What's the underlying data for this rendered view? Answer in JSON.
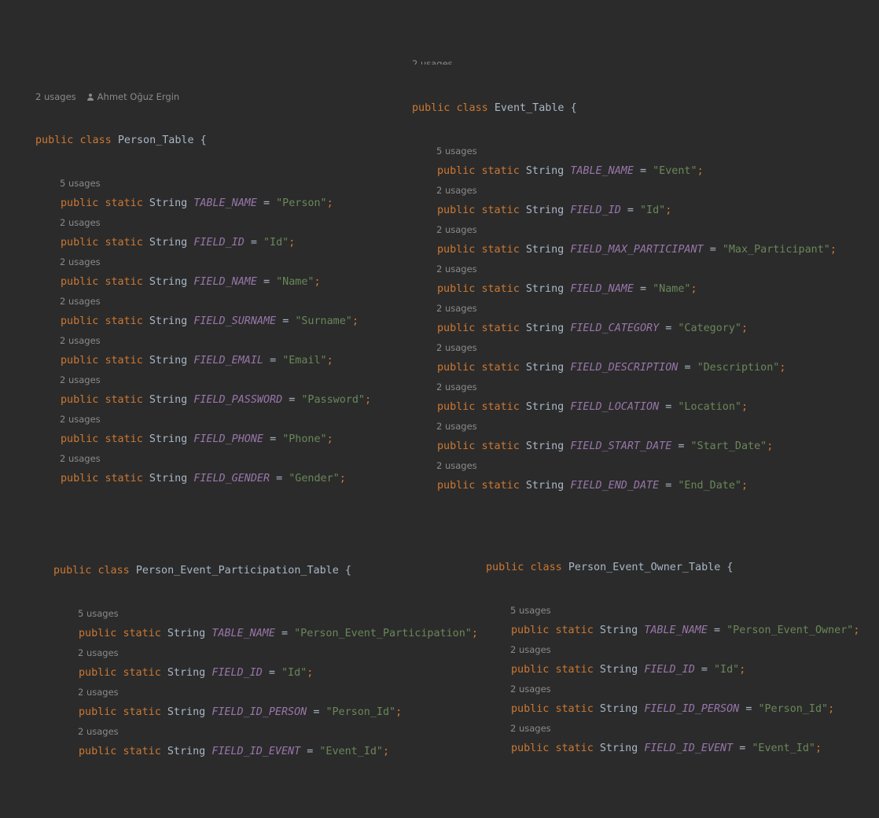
{
  "keywords": {
    "public": "public",
    "class": "class",
    "static": "static",
    "type": "String",
    "equals": "=",
    "brace": "{",
    "semicolon": ";"
  },
  "person_table": {
    "header_hint": {
      "usages": "2 usages",
      "author": "Ahmet Oğuz Ergin"
    },
    "class_name": "Person_Table",
    "fields": [
      {
        "usages": "5 usages",
        "name": "TABLE_NAME",
        "value": "\"Person\""
      },
      {
        "usages": "2 usages",
        "name": "FIELD_ID",
        "value": "\"Id\""
      },
      {
        "usages": "2 usages",
        "name": "FIELD_NAME",
        "value": "\"Name\""
      },
      {
        "usages": "2 usages",
        "name": "FIELD_SURNAME",
        "value": "\"Surname\""
      },
      {
        "usages": "2 usages",
        "name": "FIELD_EMAIL",
        "value": "\"Email\""
      },
      {
        "usages": "2 usages",
        "name": "FIELD_PASSWORD",
        "value": "\"Password\""
      },
      {
        "usages": "2 usages",
        "name": "FIELD_PHONE",
        "value": "\"Phone\""
      },
      {
        "usages": "2 usages",
        "name": "FIELD_GENDER",
        "value": "\"Gender\""
      }
    ]
  },
  "event_table": {
    "class_name": "Event_Table",
    "fields": [
      {
        "usages": "5 usages",
        "name": "TABLE_NAME",
        "value": "\"Event\""
      },
      {
        "usages": "2 usages",
        "name": "FIELD_ID",
        "value": "\"Id\""
      },
      {
        "usages": "2 usages",
        "name": "FIELD_MAX_PARTICIPANT",
        "value": "\"Max_Participant\""
      },
      {
        "usages": "2 usages",
        "name": "FIELD_NAME",
        "value": "\"Name\""
      },
      {
        "usages": "2 usages",
        "name": "FIELD_CATEGORY",
        "value": "\"Category\""
      },
      {
        "usages": "2 usages",
        "name": "FIELD_DESCRIPTION",
        "value": "\"Description\""
      },
      {
        "usages": "2 usages",
        "name": "FIELD_LOCATION",
        "value": "\"Location\""
      },
      {
        "usages": "2 usages",
        "name": "FIELD_START_DATE",
        "value": "\"Start_Date\""
      },
      {
        "usages": "2 usages",
        "name": "FIELD_END_DATE",
        "value": "\"End_Date\""
      }
    ]
  },
  "participation_table": {
    "class_name": "Person_Event_Participation_Table",
    "fields": [
      {
        "usages": "5 usages",
        "name": "TABLE_NAME",
        "value": "\"Person_Event_Participation\""
      },
      {
        "usages": "2 usages",
        "name": "FIELD_ID",
        "value": "\"Id\""
      },
      {
        "usages": "2 usages",
        "name": "FIELD_ID_PERSON",
        "value": "\"Person_Id\""
      },
      {
        "usages": "2 usages",
        "name": "FIELD_ID_EVENT",
        "value": "\"Event_Id\""
      }
    ]
  },
  "owner_table": {
    "class_name": "Person_Event_Owner_Table",
    "fields": [
      {
        "usages": "5 usages",
        "name": "TABLE_NAME",
        "value": "\"Person_Event_Owner\""
      },
      {
        "usages": "2 usages",
        "name": "FIELD_ID",
        "value": "\"Id\""
      },
      {
        "usages": "2 usages",
        "name": "FIELD_ID_PERSON",
        "value": "\"Person_Id\""
      },
      {
        "usages": "2 usages",
        "name": "FIELD_ID_EVENT",
        "value": "\"Event_Id\""
      }
    ]
  }
}
